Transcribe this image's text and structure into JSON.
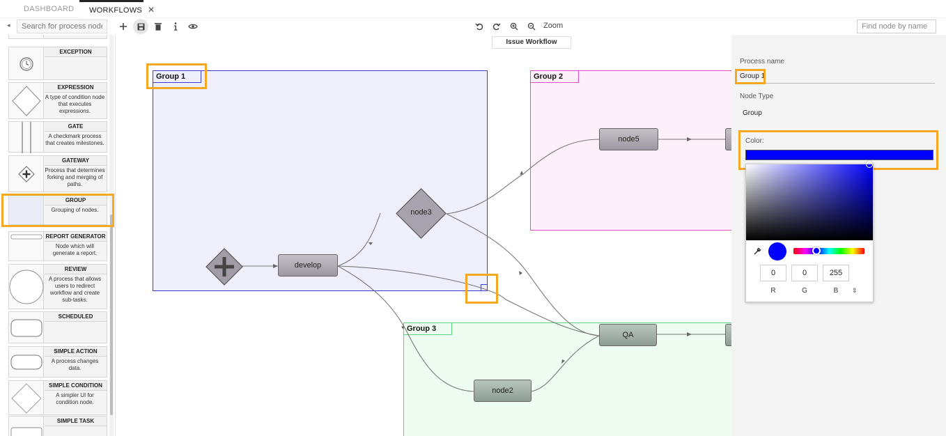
{
  "tabs": [
    {
      "label": "DASHBOARD",
      "active": false
    },
    {
      "label": "WORKFLOWS",
      "active": true,
      "close": "✕"
    }
  ],
  "toolbar": {
    "collapse_icon": "◂",
    "palette_search_placeholder": "Search for process nodes...",
    "icons": [
      "plus-icon",
      "save-icon",
      "trash-icon",
      "info-icon",
      "eye-icon",
      "undo-icon",
      "redo-icon",
      "zoom-in-icon",
      "zoom-out-icon"
    ],
    "zoom_label": "Zoom",
    "find_node_placeholder": "Find node by name"
  },
  "palette": {
    "items": [
      {
        "name": "EXCEPTION",
        "description": ""
      },
      {
        "name": "EXPRESSION",
        "description": "A type of condition node that executes expressions."
      },
      {
        "name": "GATE",
        "description": "A checkmark process that creates milestones."
      },
      {
        "name": "GATEWAY",
        "description": "Process that determines forking and merging of paths."
      },
      {
        "name": "GROUP",
        "description": "Grouping of nodes.",
        "selected": true
      },
      {
        "name": "REPORT GENERATOR",
        "description": "Node which will generate a report."
      },
      {
        "name": "REVIEW",
        "description": "A process that allows users to redirect workflow and create sub-tasks."
      },
      {
        "name": "SCHEDULED",
        "description": ""
      },
      {
        "name": "SIMPLE ACTION",
        "description": "A process changes data."
      },
      {
        "name": "SIMPLE CONDITION",
        "description": "A simpler UI for condition node."
      },
      {
        "name": "SIMPLE TASK",
        "description": ""
      }
    ]
  },
  "canvas": {
    "issue_tab": "Issue Workflow",
    "groups": [
      {
        "label": "Group 1",
        "color": "#3b3bd6"
      },
      {
        "label": "Group 2",
        "color": "#e04fc8"
      },
      {
        "label": "Group 3",
        "color": "#5bd67a"
      }
    ],
    "nodes": {
      "develop": "develop",
      "node3": "node3",
      "node5": "node5",
      "qa": "QA",
      "node2": "node2"
    }
  },
  "properties": {
    "process_name_label": "Process name",
    "process_name_value": "Group 1",
    "node_type_label": "Node Type",
    "node_type_value": "Group",
    "color_label": "Color:",
    "color_value": "#0000ff",
    "rgb": {
      "r": "0",
      "g": "0",
      "b": "255"
    },
    "rgb_labels": {
      "r": "R",
      "g": "G",
      "b": "B"
    },
    "toggle": "⇕"
  },
  "colors": {
    "highlight": "#f7a823"
  }
}
